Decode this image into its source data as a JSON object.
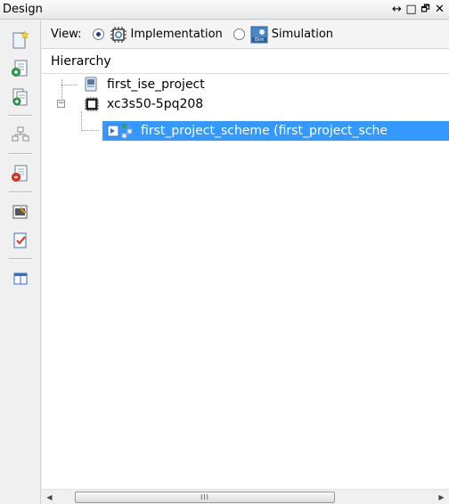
{
  "titlebar": {
    "title": "Design",
    "pin_glyph": "↔",
    "restore_glyph": "□",
    "float_glyph": "🗗",
    "close_glyph": "✕"
  },
  "toolbar": {
    "icons": [
      "new-source-icon",
      "add-source-icon",
      "add-copy-icon",
      "instantiation-icon",
      "remove-icon",
      "properties-icon",
      "check-icon",
      "panel-icon"
    ]
  },
  "viewbar": {
    "label": "View:",
    "options": [
      {
        "label": "Implementation",
        "selected": true
      },
      {
        "label": "Simulation",
        "selected": false
      }
    ],
    "simulation_icon_text": "ISim"
  },
  "hierarchy": {
    "header": "Hierarchy",
    "items": [
      {
        "label": "first_ise_project",
        "icon": "project-icon"
      },
      {
        "label": "xc3s50-5pq208",
        "icon": "chip-icon",
        "expander": "−"
      },
      {
        "label": "first_project_scheme (first_project_sche",
        "icon": "schematic-icon",
        "selected": true
      }
    ]
  },
  "scrollbar": {
    "left_arrow": "◀",
    "right_arrow": "▶",
    "thumb_grip": "III"
  },
  "colors": {
    "selection": "#3399ff",
    "background": "#f0f0f0"
  }
}
